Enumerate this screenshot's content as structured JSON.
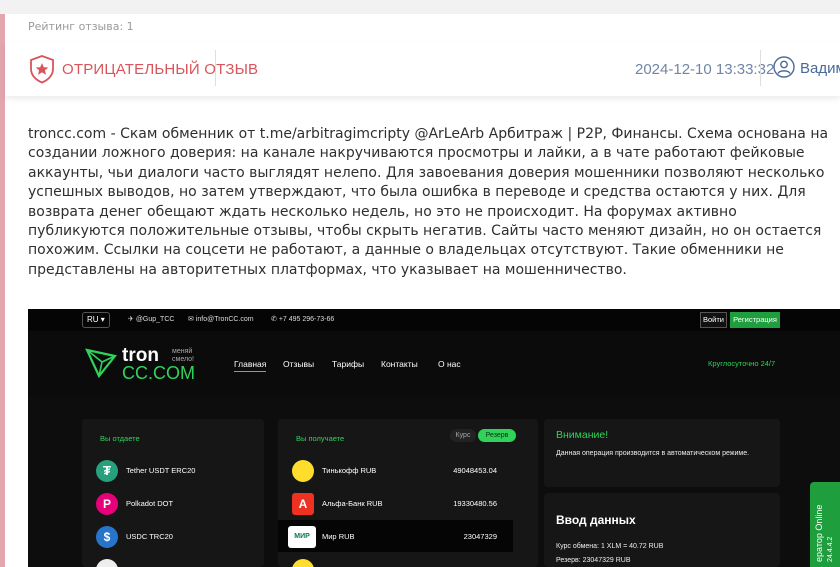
{
  "review": {
    "rating_label": "Рейтинг отзыва: 1",
    "type_label": "ОТРИЦАТЕЛЬНЫЙ ОТЗЫВ",
    "date": "2024-12-10 13:33:32",
    "author": "Вадим",
    "text": "troncc.com - Скам обменник от t.me/arbitragimcripty @ArLeArb Арбитраж | P2P, Финансы. Схема основана на создании ложного доверия: на канале накручиваются просмотры и лайки, а в чате работают фейковые аккаунты, чьи диалоги часто выглядят нелепо. Для завоевания доверия мошенники позволяют несколько успешных выводов, но затем утверждают, что была ошибка в переводе и средства остаются у них. Для возврата денег обещают ждать несколько недель, но это не происходит. На форумах активно публикуются положительные отзывы, чтобы скрыть негатив. Сайты часто меняют дизайн, но он остается похожим. Ссылки на соцсети не работают, а данные о владельцах отсутствуют. Такие обменники не представлены на авторитетных платформах, что указывает на мошенничество."
  },
  "screenshot": {
    "lang": "RU",
    "telegram": "@Gup_TCC",
    "email": "info@TronCC.com",
    "phone": "+7 495 296-73-66",
    "login": "Войти",
    "register": "Регистрация",
    "logo_main": "tron",
    "logo_domain": "CC.COM",
    "logo_tagline": "меняй смело!",
    "nav": [
      "Главная",
      "Отзывы",
      "Тарифы",
      "Контакты",
      "О нас"
    ],
    "support": "Круглосуточно 24/7",
    "give_title": "Вы отдаете",
    "give": [
      "Tether USDT ERC20",
      "Polkadot DOT",
      "USDC TRC20"
    ],
    "receive_title": "Вы получаете",
    "toggle_rate": "Курс",
    "toggle_reserve": "Резерв",
    "receive": [
      {
        "name": "Тинькофф RUB",
        "amount": "49048453.04"
      },
      {
        "name": "Альфа-Банк RUB",
        "amount": "19330480.56"
      },
      {
        "name": "Мир RUB",
        "amount": "23047329"
      }
    ],
    "mir_logo": "МИР",
    "warning_title": "Внимание!",
    "warning_text": "Данная операция производится в автоматическом режиме.",
    "input_title": "Ввод данных",
    "rate": "Курс обмена: 1 XLM = 40.72 RUB",
    "reserve": "Резерв: 23047329 RUB",
    "operator": "ератор Online",
    "operator_sub": "24.4.4.2"
  },
  "colors": {
    "negative": "#d9545b",
    "date": "#6f86a6",
    "author": "#4a6a98",
    "tron_green": "#2fd35a"
  }
}
